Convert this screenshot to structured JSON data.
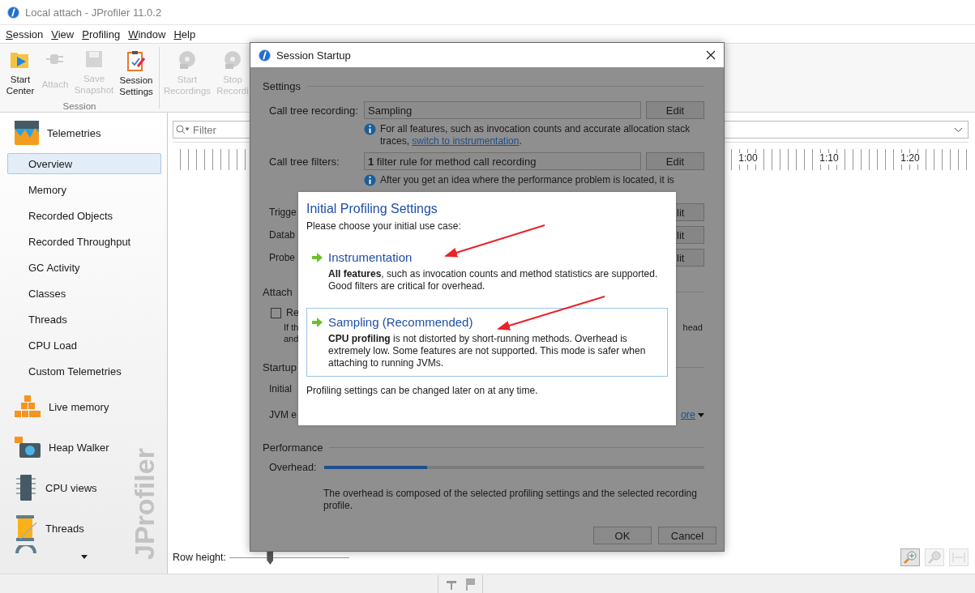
{
  "window": {
    "title": "Local attach - JProfiler 11.0.2"
  },
  "menu": [
    "Session",
    "View",
    "Profiling",
    "Window",
    "Help"
  ],
  "toolbar": {
    "groups": [
      {
        "label": "Session",
        "buttons": [
          {
            "label": "Start Center",
            "disabled": false
          },
          {
            "label": "Attach",
            "disabled": true
          },
          {
            "label": "Save Snapshot",
            "disabled": true
          },
          {
            "label": "Session Settings",
            "disabled": false
          }
        ]
      },
      {
        "buttons": [
          {
            "label": "Start Recordings",
            "disabled": true
          },
          {
            "label": "Stop Recordi",
            "disabled": true
          }
        ]
      }
    ]
  },
  "sidebar": {
    "sections": [
      {
        "label": "Telemetries",
        "children": [
          {
            "label": "Overview",
            "selected": true
          },
          {
            "label": "Memory",
            "selected": false
          },
          {
            "label": "Recorded Objects",
            "selected": false
          },
          {
            "label": "Recorded Throughput",
            "selected": false
          },
          {
            "label": "GC Activity",
            "selected": false
          },
          {
            "label": "Classes",
            "selected": false
          },
          {
            "label": "Threads",
            "selected": false
          },
          {
            "label": "CPU Load",
            "selected": false
          },
          {
            "label": "Custom Telemetries",
            "selected": false
          }
        ]
      },
      {
        "label": "Live memory"
      },
      {
        "label": "Heap Walker"
      },
      {
        "label": "CPU views"
      },
      {
        "label": "Threads"
      }
    ],
    "logo": "JProfiler"
  },
  "main": {
    "filter": {
      "placeholder": "Filter"
    },
    "ruler_labels": [
      "1:00",
      "1:10",
      "1:20"
    ],
    "row_height": {
      "label": "Row height:",
      "level": 0.34
    }
  },
  "dialog": {
    "title": "Session Startup",
    "settings": {
      "heading": "Settings",
      "rows": [
        {
          "label": "Call tree recording:",
          "value": "Sampling",
          "button": "Edit",
          "info": {
            "text": "For all features, such as invocation counts and accurate allocation stack traces, ",
            "link": "switch to instrumentation",
            "after": "."
          }
        },
        {
          "label": "Call tree filters:",
          "value": "**1** filter rule for method call recording",
          "button": "Edit",
          "info": {
            "text": "After you get an idea where the performance problem is located, it is"
          }
        }
      ],
      "covered_rows": [
        {
          "label": "Trigge",
          "button": "lit"
        },
        {
          "label": "Datab",
          "button": "lit"
        },
        {
          "label": "Probe",
          "button": "lit"
        }
      ]
    },
    "attach": {
      "heading": "Attach",
      "checkbox": {
        "label": "Re",
        "checked": false
      },
      "note_left": [
        "If th",
        "and"
      ],
      "note_right": "head"
    },
    "startup": {
      "heading": "Startup",
      "rows": [
        "Initial",
        "JVM e"
      ],
      "more_link": "ore"
    },
    "performance": {
      "heading": "Performance",
      "label": "Overhead:",
      "level": 0.27,
      "note": "The overhead is composed of the selected profiling settings and the selected recording profile."
    },
    "buttons": [
      "OK",
      "Cancel"
    ]
  },
  "popup": {
    "title": "Initial Profiling Settings",
    "prompt": "Please choose your initial use case:",
    "options": [
      {
        "title": "Instrumentation",
        "description": "**All features**, such as invocation counts and method statistics are supported. Good filters are critical for overhead.",
        "selected": false
      },
      {
        "title": "Sampling (Recommended)",
        "description": "**CPU profiling** is not distorted by short-running methods. Overhead is extremely low. Some features are not supported. This mode is safer when attaching to running JVMs.",
        "selected": true
      }
    ],
    "footer": "Profiling settings can be changed later on at any time."
  }
}
